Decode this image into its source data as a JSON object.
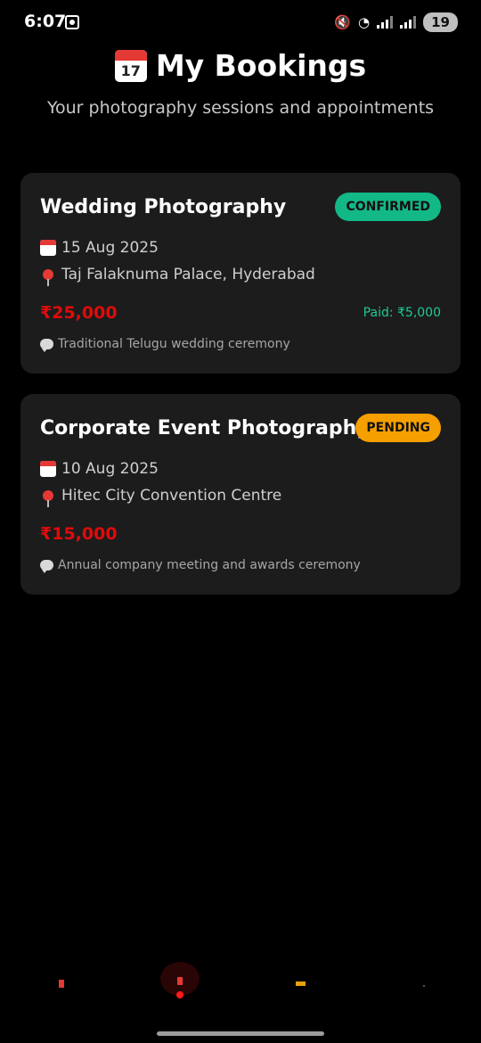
{
  "status_bar": {
    "time": "6:07",
    "battery": "19"
  },
  "header": {
    "title": "My Bookings",
    "subtitle": "Your photography sessions and appointments"
  },
  "bookings": [
    {
      "title": "Wedding Photography",
      "status": "CONFIRMED",
      "date": "15 Aug 2025",
      "location": "Taj Falaknuma Palace, Hyderabad",
      "price": "₹25,000",
      "paid": "Paid: ₹5,000",
      "note": "Traditional Telugu wedding ceremony"
    },
    {
      "title": "Corporate Event Photography",
      "status": "PENDING",
      "date": "10 Aug 2025",
      "location": "Hitec City Convention Centre",
      "price": "₹15,000",
      "note": "Annual company meeting and awards ceremony"
    }
  ],
  "colors": {
    "confirmed": "#12b886",
    "pending": "#f59f00",
    "price": "#e00b0b",
    "paid": "#20c997",
    "card_bg": "#1c1c1c"
  },
  "bottom_nav": {
    "items": [
      "home-icon",
      "bookings-icon",
      "gallery-icon",
      "profile-icon"
    ],
    "active": "bookings-icon"
  }
}
